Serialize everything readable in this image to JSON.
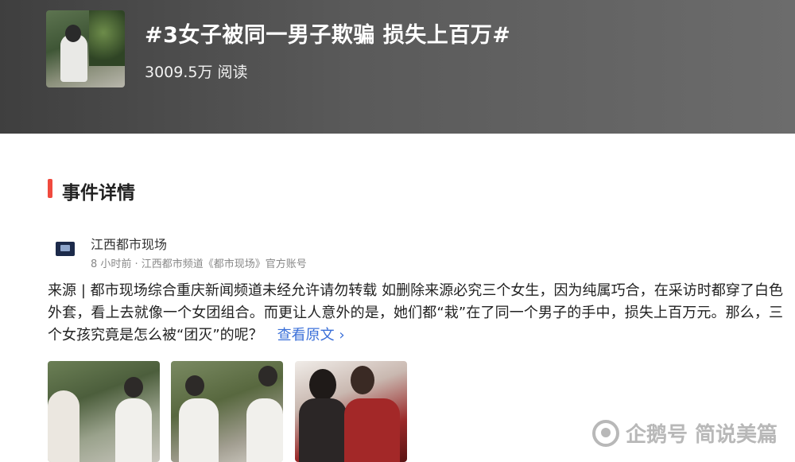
{
  "topic": {
    "title": "#3女子被同一男子欺骗 损失上百万#",
    "read_count": "3009.5万 阅读"
  },
  "section": {
    "title": "事件详情"
  },
  "post": {
    "author": "江西都市现场",
    "meta": "8 小时前 · 江西都市频道《都市现场》官方账号",
    "body": "来源 | 都市现场综合重庆新闻频道未经允许请勿转载 如删除来源必究三个女生，因为纯属巧合，在采访时都穿了白色外套，看上去就像一个女团组合。而更让人意外的是，她们都“栽”在了同一个男子的手中，损失上百万元。那么，三个女孩究竟是怎么被“团灭”的呢？",
    "read_more": "查看原文 ›"
  },
  "watermark": {
    "text": "企鹅号 简说美篇"
  },
  "colors": {
    "accent_bar": "#f04a3e",
    "link": "#3a6fd8"
  }
}
